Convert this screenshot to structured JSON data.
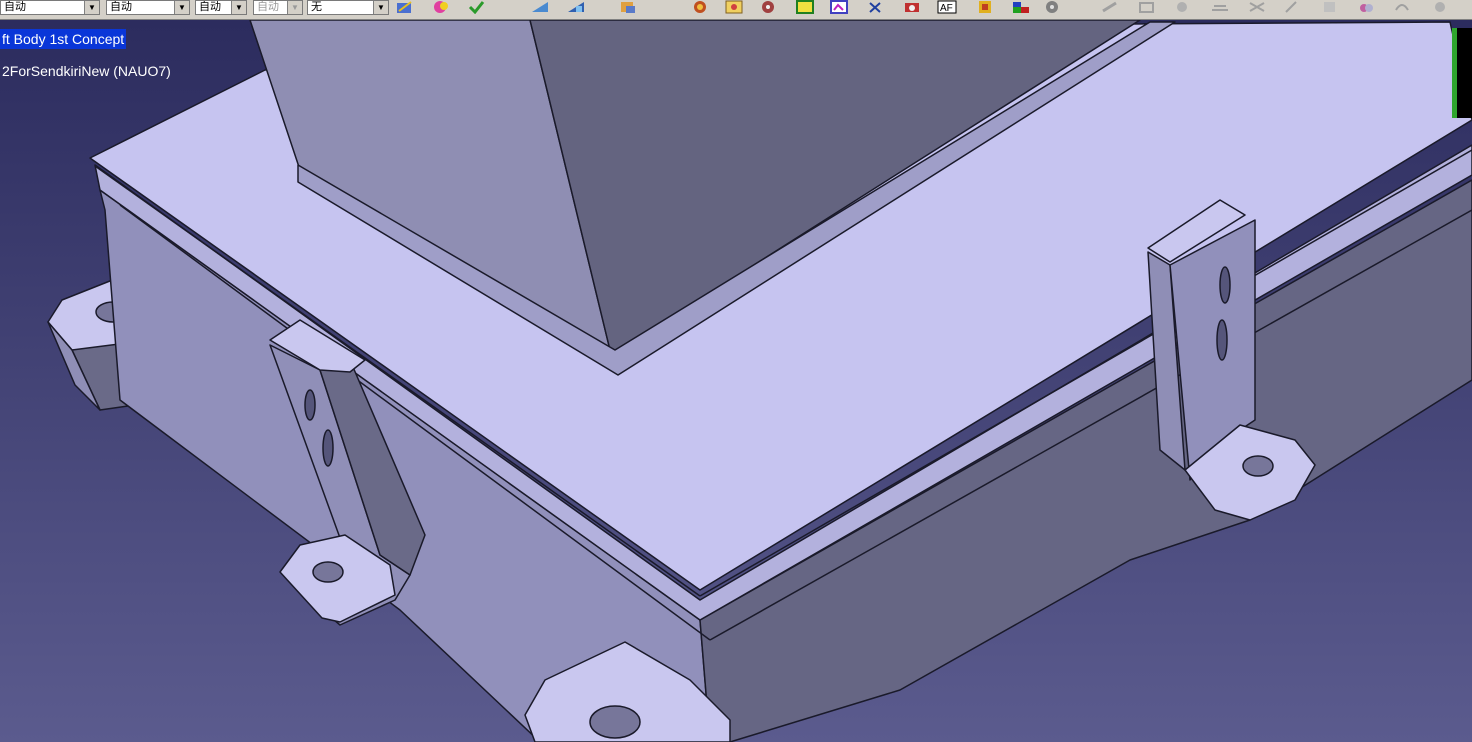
{
  "toolbar": {
    "combos": [
      {
        "value": "自动",
        "enabled": true
      },
      {
        "value": "自动",
        "enabled": true
      },
      {
        "value": "自动",
        "enabled": true
      },
      {
        "value": "自动",
        "enabled": false
      },
      {
        "value": "无",
        "enabled": true
      }
    ],
    "icons": [
      "sketch-icon",
      "color-icon",
      "check-icon",
      "render-icon",
      "render-shade-icon",
      "tools-icon",
      "material-icon",
      "image-icon",
      "material-lib-icon",
      "frame-icon",
      "picture-icon",
      "delete-icon",
      "camera-icon",
      "text-icon",
      "note-icon",
      "window-icon",
      "options-icon",
      "disabled-tool-icon",
      "disabled-tool-icon",
      "disabled-tool-icon",
      "disabled-tool-icon",
      "disabled-tool-icon",
      "disabled-tool-icon",
      "disabled-tool-icon",
      "disabled-tool-icon",
      "disabled-tool-icon",
      "disabled-tool-icon"
    ]
  },
  "tree": {
    "selected_label": "ft Body 1st Concept",
    "product_label": "2ForSendkiriNew  (NAUO7)"
  },
  "colors": {
    "background_top": "#2c2c5e",
    "background_bottom": "#5b5b8e",
    "selection": "#0a36d8",
    "part_light": "#c6c4f0",
    "part_mid": "#9291bd",
    "part_dark": "#666683"
  }
}
